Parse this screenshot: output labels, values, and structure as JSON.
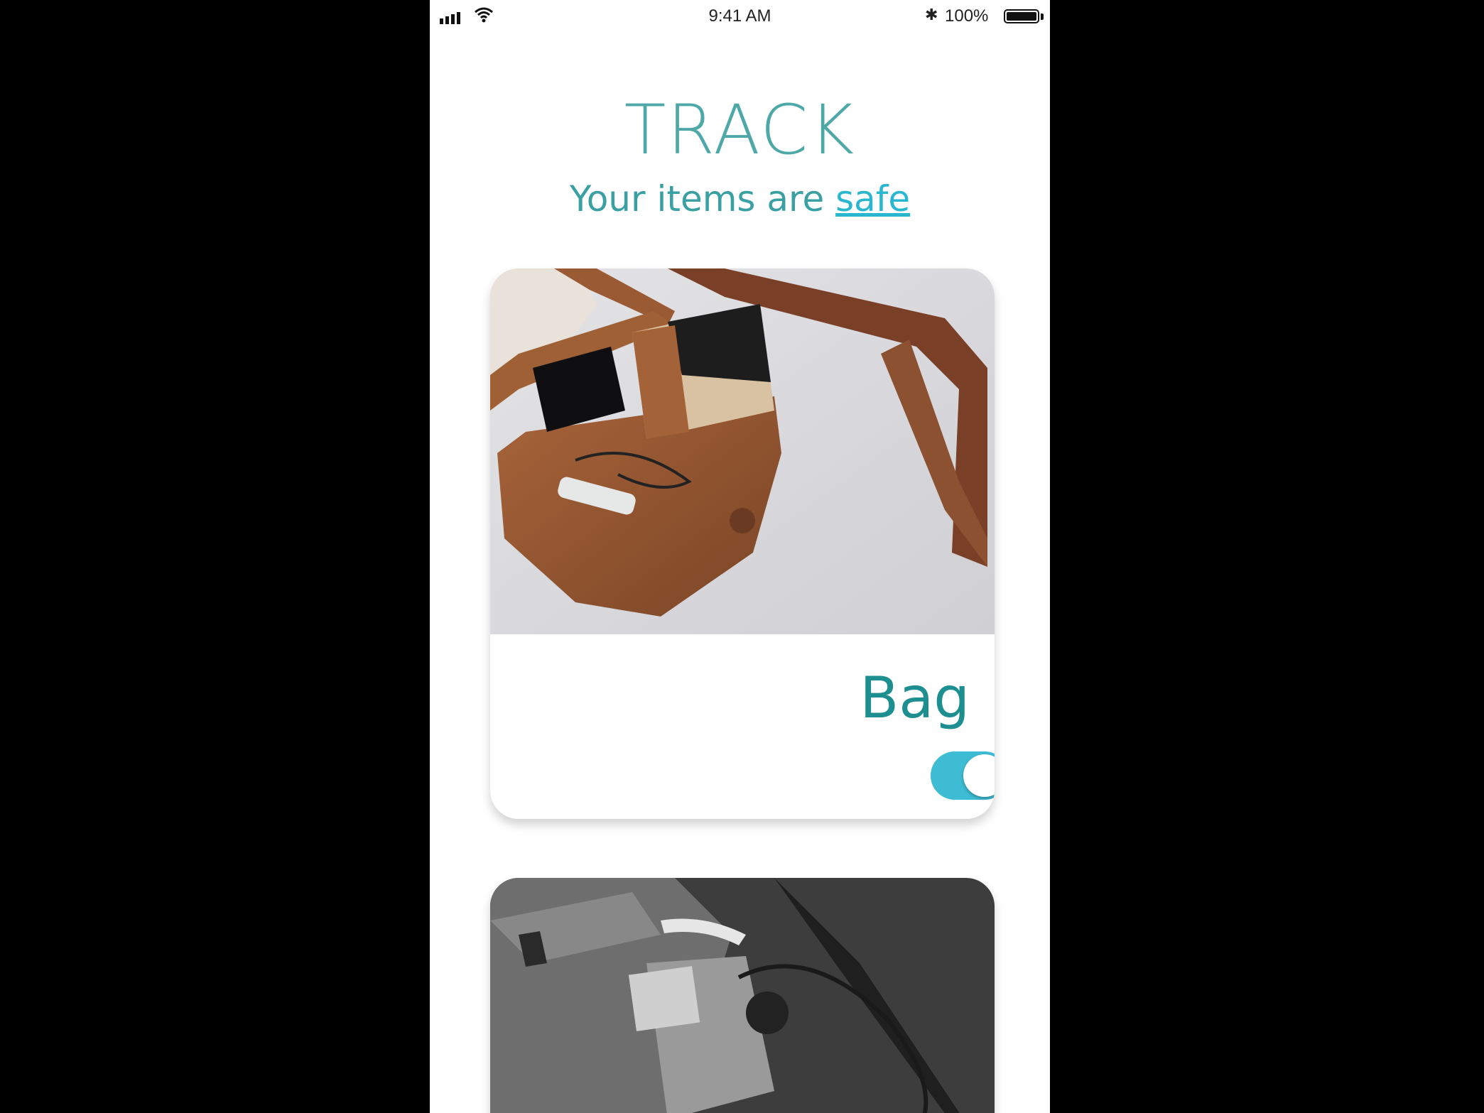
{
  "status_bar": {
    "time": "9:41 AM",
    "bluetooth_icon": "bluetooth-icon",
    "battery_percent": "100%",
    "signal_icon": "signal-bars-icon",
    "wifi_icon": "wifi-icon",
    "battery_icon": "battery-icon"
  },
  "header": {
    "title": "TRACK",
    "subtitle_prefix": "Your items are ",
    "subtitle_link": "safe"
  },
  "items": [
    {
      "label": "Bag",
      "tracking_enabled": true,
      "photo": "brown leather bag with wallet and phone"
    },
    {
      "label": "",
      "photo": "black and white backpack with sunglasses and accessories"
    }
  ],
  "colors": {
    "title": "#4fa8a8",
    "subtitle": "#3aa0a3",
    "link": "#29b6cf",
    "label": "#1e8f90",
    "toggle_on": "#3dbcd3"
  }
}
